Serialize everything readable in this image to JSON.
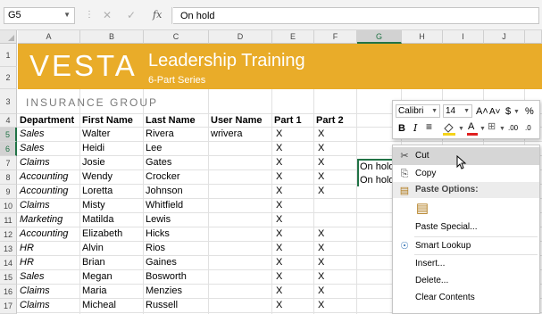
{
  "formula_bar": {
    "name_box": "G5",
    "fx_label": "fx",
    "value": "On hold"
  },
  "columns": [
    "A",
    "B",
    "C",
    "D",
    "E",
    "F",
    "G",
    "H",
    "I",
    "J"
  ],
  "selected_column": "G",
  "rows": [
    "1",
    "2",
    "3",
    "4",
    "5",
    "6",
    "7",
    "8",
    "9",
    "10",
    "11",
    "12",
    "13",
    "14",
    "15",
    "16",
    "17"
  ],
  "selected_rows": [
    "5",
    "6"
  ],
  "banner": {
    "title": "VESTA",
    "subtitle": "Leadership Training",
    "series": "6-Part Series",
    "color": "#e9ac29"
  },
  "company": "INSURANCE GROUP",
  "headers": [
    "Department",
    "First Name",
    "Last Name",
    "User Name",
    "Part 1",
    "Part 2"
  ],
  "table": [
    [
      "Sales",
      "Walter",
      "Rivera",
      "wrivera",
      "X",
      "X"
    ],
    [
      "Sales",
      "Heidi",
      "Lee",
      "",
      "X",
      "X"
    ],
    [
      "Claims",
      "Josie",
      "Gates",
      "",
      "X",
      "X"
    ],
    [
      "Accounting",
      "Wendy",
      "Crocker",
      "",
      "X",
      "X"
    ],
    [
      "Accounting",
      "Loretta",
      "Johnson",
      "",
      "X",
      "X"
    ],
    [
      "Claims",
      "Misty",
      "Whitfield",
      "",
      "X",
      ""
    ],
    [
      "Marketing",
      "Matilda",
      "Lewis",
      "",
      "X",
      ""
    ],
    [
      "Accounting",
      "Elizabeth",
      "Hicks",
      "",
      "X",
      "X"
    ],
    [
      "HR",
      "Alvin",
      "Rios",
      "",
      "X",
      "X"
    ],
    [
      "HR",
      "Brian",
      "Gaines",
      "",
      "X",
      "X"
    ],
    [
      "Sales",
      "Megan",
      "Bosworth",
      "",
      "X",
      "X"
    ],
    [
      "Claims",
      "Maria",
      "Menzies",
      "",
      "X",
      "X"
    ],
    [
      "Claims",
      "Micheal",
      "Russell",
      "",
      "X",
      "X"
    ]
  ],
  "selection_values": [
    "On hold",
    "On hold"
  ],
  "mini_toolbar": {
    "font": "Calibri",
    "size": "14",
    "grow_icon": "A˄",
    "shrink_icon": "A˅",
    "currency": "$",
    "percent": "%",
    "bold": "B",
    "italic": "I",
    "font_color_letter": "A",
    "decimal_increase": ".00",
    "decimal_decrease": ".0",
    "font_color": "#e02020",
    "fill_color": "#f5d31a"
  },
  "context_menu": {
    "items": [
      {
        "label": "Cut",
        "icon": "scissors-icon",
        "glyph": "✂"
      },
      {
        "label": "Copy",
        "icon": "copy-icon",
        "glyph": "⎘"
      },
      {
        "label": "Paste Options:",
        "icon": "paste-icon",
        "glyph": "▤"
      },
      {
        "label": "",
        "icon": "paste-clipboard-icon",
        "glyph": "▤"
      },
      {
        "label": "Paste Special...",
        "icon": "",
        "glyph": ""
      },
      {
        "label": "Smart Lookup",
        "icon": "smart-lookup-icon",
        "glyph": "☉"
      },
      {
        "label": "Insert...",
        "icon": "",
        "glyph": ""
      },
      {
        "label": "Delete...",
        "icon": "",
        "glyph": ""
      },
      {
        "label": "Clear Contents",
        "icon": "",
        "glyph": ""
      }
    ]
  }
}
